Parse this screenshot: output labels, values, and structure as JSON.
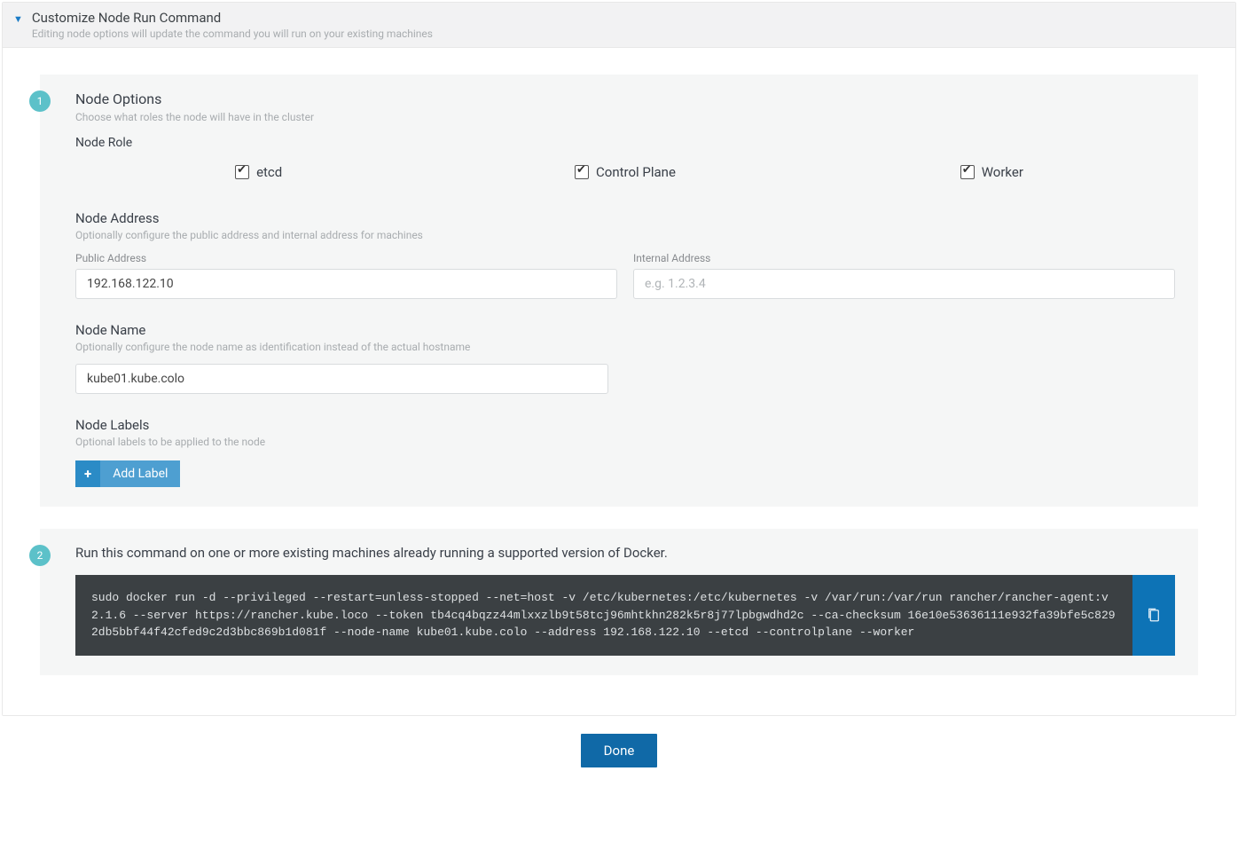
{
  "header": {
    "title": "Customize Node Run Command",
    "subtitle": "Editing node options will update the command you will run on your existing machines"
  },
  "step1": {
    "badge": "1",
    "title": "Node Options",
    "subtitle": "Choose what roles the node will have in the cluster",
    "node_role_label": "Node Role",
    "roles": {
      "etcd": "etcd",
      "control_plane": "Control Plane",
      "worker": "Worker"
    },
    "node_address": {
      "title": "Node Address",
      "subtitle": "Optionally configure the public address and internal address for machines",
      "public_label": "Public Address",
      "public_value": "192.168.122.10",
      "internal_label": "Internal Address",
      "internal_placeholder": "e.g. 1.2.3.4"
    },
    "node_name": {
      "title": "Node Name",
      "subtitle": "Optionally configure the node name as identification instead of the actual hostname",
      "value": "kube01.kube.colo"
    },
    "node_labels": {
      "title": "Node Labels",
      "subtitle": "Optional labels to be applied to the node",
      "add_button": "Add Label"
    }
  },
  "step2": {
    "badge": "2",
    "title": "Run this command on one or more existing machines already running a supported version of Docker.",
    "command": "sudo docker run -d --privileged --restart=unless-stopped --net=host -v /etc/kubernetes:/etc/kubernetes -v /var/run:/var/run rancher/rancher-agent:v2.1.6 --server https://rancher.kube.loco --token tb4cq4bqzz44mlxxzlb9t58tcj96mhtkhn282k5r8j77lpbgwdhd2c --ca-checksum 16e10e53636111e932fa39bfe5c8292db5bbf44f42cfed9c2d3bbc869b1d081f --node-name kube01.kube.colo --address 192.168.122.10 --etcd --controlplane --worker"
  },
  "footer": {
    "done": "Done"
  }
}
